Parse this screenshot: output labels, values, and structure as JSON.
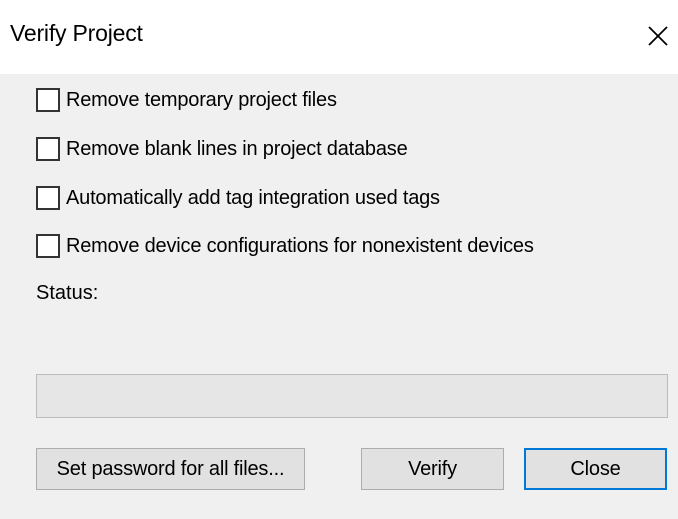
{
  "window": {
    "title": "Verify Project",
    "close_icon": "close-icon"
  },
  "options": [
    {
      "label": "Remove temporary project files",
      "checked": false
    },
    {
      "label": "Remove blank lines in project database",
      "checked": false
    },
    {
      "label": "Automatically add tag integration used tags",
      "checked": false
    },
    {
      "label": "Remove device configurations for nonexistent devices",
      "checked": false
    }
  ],
  "status": {
    "label": "Status:",
    "progress": 0
  },
  "buttons": {
    "set_password": "Set password for all files...",
    "verify": "Verify",
    "close": "Close"
  },
  "colors": {
    "accent": "#0078d7",
    "dialog_bg": "#f0f0f0",
    "button_bg": "#e1e1e1"
  }
}
